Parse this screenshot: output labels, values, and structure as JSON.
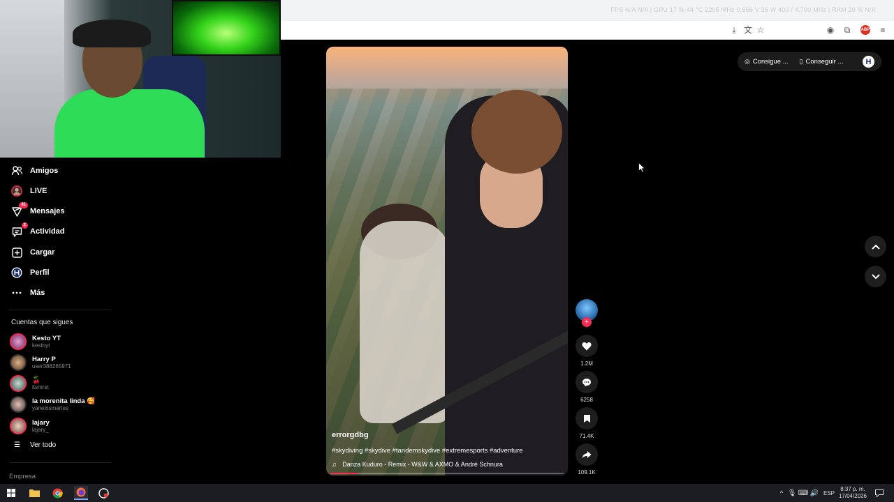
{
  "browser": {
    "stats_text": "FPS  N/A  N/A  |  GPU  17 %  44 °C  2205 MHz 0.656 V  26 W  400 / 4.700 MHz  |  RAM  20 %  N/A"
  },
  "sidebar": {
    "items": [
      {
        "label": "Amigos",
        "icon": "friends-icon"
      },
      {
        "label": "LIVE",
        "icon": "live-icon"
      },
      {
        "label": "Mensajes",
        "icon": "messages-icon",
        "badge": "41"
      },
      {
        "label": "Actividad",
        "icon": "activity-icon",
        "badge": "2"
      },
      {
        "label": "Cargar",
        "icon": "upload-icon"
      },
      {
        "label": "Perfil",
        "icon": "profile-icon"
      },
      {
        "label": "Más",
        "icon": "more-icon"
      }
    ],
    "following_title": "Cuentas que sigues",
    "accounts": [
      {
        "name": "Kesto YT",
        "handle": "kestoyt"
      },
      {
        "name": "Harry P",
        "handle": "user388265971"
      },
      {
        "name": "🍒",
        "handle": "itsmrst"
      },
      {
        "name": "la morenita linda 🥰",
        "handle": "yaneirismartes"
      },
      {
        "name": "lajary",
        "handle": "lajary_"
      }
    ],
    "see_all": "Ver todo",
    "company": "Empresa"
  },
  "video": {
    "author": "errorgdbg",
    "description": "#skydiving #skydive #tandemskydive #extremesports #adventure",
    "music": "Danza Kuduro - Remix - W&W & AXMO & André Schnura",
    "progress": 0.12
  },
  "actions": {
    "likes": "1.2M",
    "comments": "6258",
    "saves": "71.4K",
    "shares": "109.1K"
  },
  "top_pill": {
    "item1": "Consigue ...",
    "item2": "Conseguir ...",
    "profile_letter": "H"
  },
  "taskbar": {
    "lang": "ESP",
    "time": "8:37 p. m.",
    "date": "17/04/2026"
  },
  "colors": {
    "accent": "#fe2c55",
    "background": "#000000"
  }
}
